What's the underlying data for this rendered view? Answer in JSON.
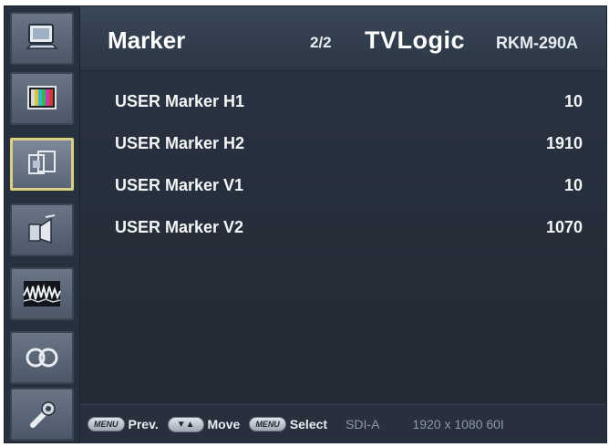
{
  "header": {
    "title": "Marker",
    "page": "2/2",
    "brand": "TVLogic",
    "model": "RKM-290A"
  },
  "sidebar": {
    "items": [
      {
        "icon": "monitor-icon"
      },
      {
        "icon": "color-bars-icon"
      },
      {
        "icon": "marker-frames-icon",
        "active": true
      },
      {
        "icon": "audio-icon"
      },
      {
        "icon": "waveform-icon"
      },
      {
        "icon": "link-icon"
      },
      {
        "icon": "wrench-icon"
      }
    ]
  },
  "rows": [
    {
      "label": "USER Marker H1",
      "value": "10"
    },
    {
      "label": "USER Marker H2",
      "value": "1910"
    },
    {
      "label": "USER Marker V1",
      "value": "10"
    },
    {
      "label": "USER Marker V2",
      "value": "1070"
    }
  ],
  "footer": {
    "menu_key": "MENU",
    "prev_label": "Prev.",
    "arrows_key": "▼▲",
    "move_label": "Move",
    "select_key": "MENU",
    "select_label": "Select",
    "input": "SDI-A",
    "format": "1920 x 1080 60I"
  }
}
